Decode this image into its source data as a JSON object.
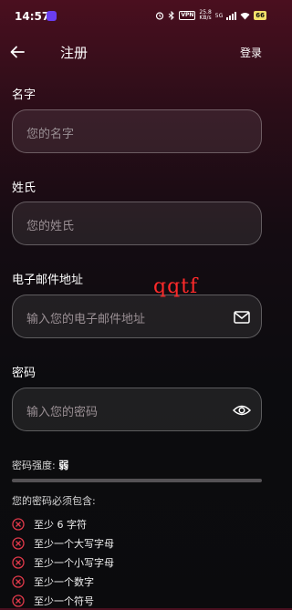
{
  "status_bar": {
    "time": "14:57",
    "vpn": "VPN",
    "net_speed_value": "25.8",
    "net_speed_unit": "KB/s",
    "network": "5G",
    "battery": "66"
  },
  "header": {
    "title": "注册",
    "login_label": "登录"
  },
  "form": {
    "first_name": {
      "label": "名字",
      "placeholder": "您的名字"
    },
    "last_name": {
      "label": "姓氏",
      "placeholder": "您的姓氏"
    },
    "email": {
      "label": "电子邮件地址",
      "placeholder": "输入您的电子邮件地址",
      "icon": "mail-icon"
    },
    "password": {
      "label": "密码",
      "placeholder": "输入您的密码",
      "icon": "eye-icon"
    }
  },
  "watermark": "qqtf",
  "password_strength": {
    "label": "密码强度: ",
    "value": "弱",
    "level": 0
  },
  "requirements": {
    "title": "您的密码必须包含:",
    "items": [
      {
        "text": "至少 6 字符",
        "met": false
      },
      {
        "text": "至少一个大写字母",
        "met": false
      },
      {
        "text": "至少一个小写字母",
        "met": false
      },
      {
        "text": "至少一个数字",
        "met": false
      },
      {
        "text": "至少一个符号",
        "met": false
      }
    ]
  },
  "colors": {
    "unmet": "#e0394a",
    "watermark": "#ff2a2a",
    "accent_battery": "#f2e06a"
  }
}
